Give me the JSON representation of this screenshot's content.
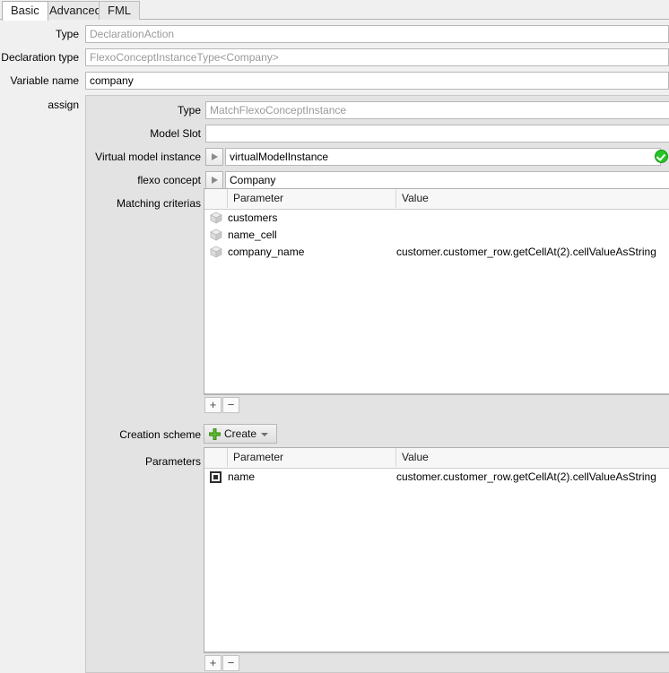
{
  "tabs": [
    {
      "id": "basic",
      "label": "Basic",
      "active": true
    },
    {
      "id": "advanced",
      "label": "Advanced",
      "active": false
    },
    {
      "id": "fml",
      "label": "FML",
      "active": false
    }
  ],
  "basic_form": {
    "type_label": "Type",
    "type_value": "DeclarationAction",
    "declaration_type_label": "Declaration type",
    "declaration_type_value": "FlexoConceptInstanceType<Company>",
    "variable_name_label": "Variable name",
    "variable_name_value": "company",
    "assign_label": "assign"
  },
  "assign": {
    "type_label": "Type",
    "type_value": "MatchFlexoConceptInstance",
    "model_slot_label": "Model Slot",
    "model_slot_value": "",
    "virtual_model_instance_label": "Virtual model instance",
    "virtual_model_instance_value": "virtualModelInstance",
    "virtual_model_instance_status": "valid",
    "flexo_concept_label": "flexo concept",
    "flexo_concept_value": "Company",
    "matching_criterias_label": "Matching criterias",
    "creation_scheme_label": "Creation scheme",
    "parameters_label": "Parameters"
  },
  "matching_table": {
    "columns": [
      "",
      "Parameter",
      "Value"
    ],
    "rows": [
      {
        "icon": "cube-icon",
        "parameter": "customers",
        "value": ""
      },
      {
        "icon": "cube-icon",
        "parameter": "name_cell",
        "value": ""
      },
      {
        "icon": "cube-icon",
        "parameter": "company_name",
        "value": "customer.customer_row.getCellAt(2).cellValueAsString"
      }
    ]
  },
  "parameters_table": {
    "columns": [
      "",
      "Parameter",
      "Value"
    ],
    "rows": [
      {
        "icon": "field-square-icon",
        "parameter": "name",
        "value": "customer.customer_row.getCellAt(2).cellValueAsString"
      }
    ]
  },
  "creation_scheme": {
    "button_label": "Create",
    "plus_icon": "green-plus-icon",
    "caret_icon": "chevron-down-icon"
  },
  "toolbars": {
    "add_label": "+",
    "remove_label": "−",
    "settings_icon": "gear-icon"
  },
  "colors": {
    "accent_green": "#25c425",
    "plus_green": "#4caf2a",
    "panel_bg": "#e3e3e3",
    "window_bg": "#f0f0f0",
    "readonly_text": "#9a9a9a"
  }
}
